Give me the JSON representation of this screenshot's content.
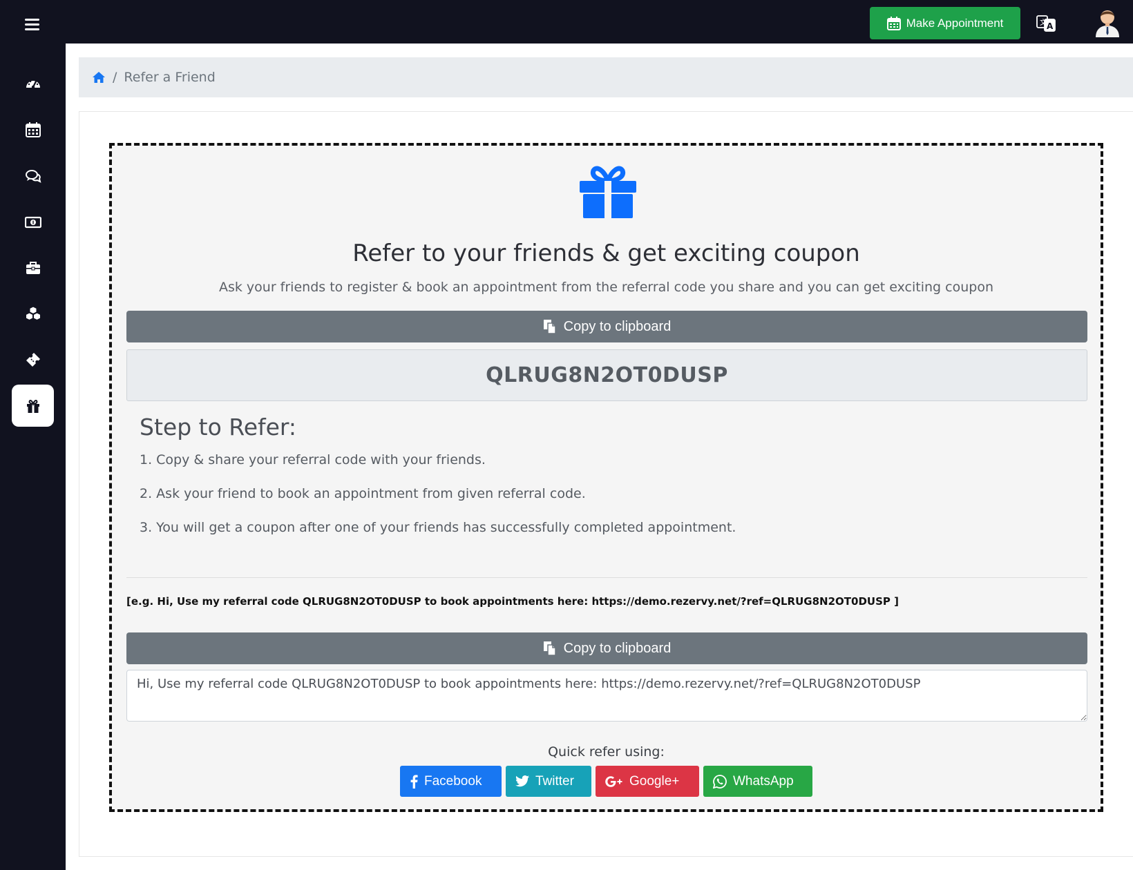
{
  "header": {
    "make_appointment_label": "Make Appointment"
  },
  "sidebar": {
    "items": [
      {
        "icon": "dashboard-gauge-icon"
      },
      {
        "icon": "calendar-icon"
      },
      {
        "icon": "chat-comments-icon"
      },
      {
        "icon": "money-bill-icon"
      },
      {
        "icon": "briefcase-icon"
      },
      {
        "icon": "cubes-icon"
      },
      {
        "icon": "ticket-icon"
      },
      {
        "icon": "gift-icon",
        "active": true
      }
    ]
  },
  "breadcrumb": {
    "current": "Refer a Friend"
  },
  "referral": {
    "headline": "Refer to your friends & get exciting coupon",
    "subline": "Ask your friends to register & book an appointment from the referral code you share and you can get exciting coupon",
    "copy_label": "Copy to clipboard",
    "code": "QLRUG8N2OT0DUSP",
    "steps_title": "Step to Refer:",
    "steps": [
      "1. Copy & share your referral code with your friends.",
      "2. Ask your friend to book an appointment from given referral code.",
      "3. You will get a coupon after one of your friends has successfully completed appointment."
    ],
    "example": "[e.g. Hi, Use my referral code QLRUG8N2OT0DUSP to book appointments here: https://demo.rezervy.net/?ref=QLRUG8N2OT0DUSP ]",
    "message_copy_label": "Copy to clipboard",
    "message": "Hi, Use my referral code QLRUG8N2OT0DUSP to book appointments here: https://demo.rezervy.net/?ref=QLRUG8N2OT0DUSP",
    "quick_refer_label": "Quick refer using:",
    "share": {
      "facebook": "Facebook",
      "twitter": "Twitter",
      "google": "Google+",
      "whatsapp": "WhatsApp"
    }
  },
  "colors": {
    "topbar": "#11121f",
    "accent_green": "#1ea14a",
    "primary_blue": "#1877f2",
    "secondary_gray": "#6c757d",
    "twitter_teal": "#17a2b8",
    "google_red": "#dc3545",
    "whatsapp_green": "#28a745"
  }
}
